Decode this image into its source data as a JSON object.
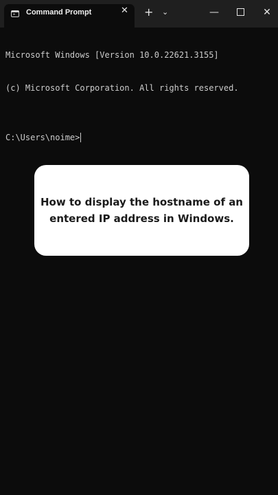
{
  "window": {
    "tab_title": "Command Prompt",
    "tab_close_glyph": "✕",
    "new_tab_glyph": "+",
    "dropdown_glyph": "⌄",
    "minimize_glyph": "—",
    "close_glyph": "✕",
    "icons": {
      "tab": "terminal-icon",
      "minimize": "minimize-icon",
      "maximize": "maximize-icon",
      "close": "close-icon"
    }
  },
  "console": {
    "lines": [
      "Microsoft Windows [Version 10.0.22621.3155]",
      "(c) Microsoft Corporation. All rights reserved."
    ],
    "prompt": "C:\\Users\\noime>"
  },
  "overlay": {
    "text": "How to display the hostname of an entered IP address in Windows."
  },
  "colors": {
    "background": "#0c0c0c",
    "titlebar": "#1f1f1f",
    "console_text": "#cccccc",
    "card": "#ffffff"
  }
}
